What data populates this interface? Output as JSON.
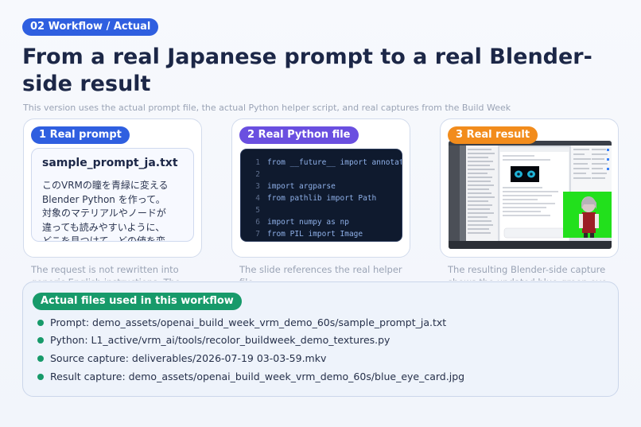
{
  "section_label": "02  Workflow / Actual",
  "title": "From a real Japanese prompt to a real Blender-side result",
  "subtitle": "This version uses the actual prompt file, the actual Python helper script, and real captures from the Build Week workflow in the intended demo order.",
  "cards": {
    "prompt": {
      "label": "1  Real prompt",
      "file_name": "sample_prompt_ja.txt",
      "body": "このVRMの瞳を青緑に変える\nBlender Python を作って。\n対象のマテリアルやノードが\n違っても読みやすいように、\nどこを見つけて、どの値を変",
      "caption": "The request is not rewritten into generic English instructions. The"
    },
    "python": {
      "label": "2  Real Python file",
      "code": [
        {
          "n": "1",
          "src": "from __future__ import annotations"
        },
        {
          "n": "2",
          "src": ""
        },
        {
          "n": "3",
          "src": "import argparse"
        },
        {
          "n": "4",
          "src": "from pathlib import Path"
        },
        {
          "n": "5",
          "src": ""
        },
        {
          "n": "6",
          "src": "import numpy as np"
        },
        {
          "n": "7",
          "src": "from PIL import Image"
        }
      ],
      "caption": "The slide references the real helper file"
    },
    "result": {
      "label": "3  Real result",
      "caption": "The resulting Blender-side capture shows the updated blue-green eye"
    }
  },
  "files_panel": {
    "label": "Actual files used in this workflow",
    "items": [
      "Prompt: demo_assets/openai_build_week_vrm_demo_60s/sample_prompt_ja.txt",
      "Python: L1_active/vrm_ai/tools/recolor_buildweek_demo_textures.py",
      "Source capture: deliverables/2026-07-19 03-03-59.mkv",
      "Result capture: demo_assets/openai_build_week_vrm_demo_60s/blue_eye_card.jpg"
    ]
  },
  "colors": {
    "section_pill": "#2f5fe0",
    "prompt_pill": "#2f5fe0",
    "python_pill": "#6a4fe0",
    "result_pill": "#f28c1c",
    "files_pill": "#179a6a"
  }
}
